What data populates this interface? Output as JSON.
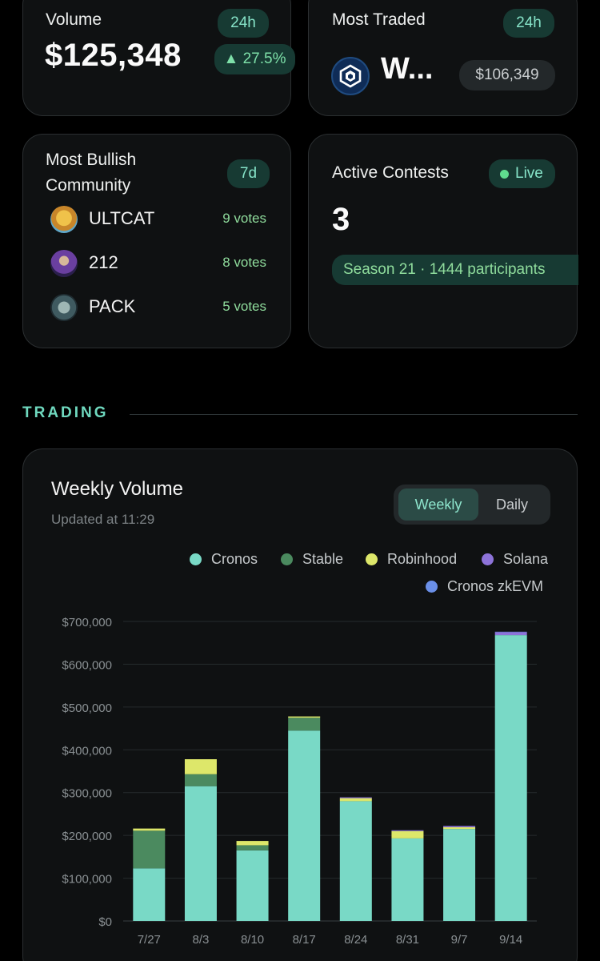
{
  "colors": {
    "accent": "#86e3c8",
    "card_bg": "#0f1112",
    "positive": "#7ee0a9",
    "cronos": "#79d9c6",
    "stable": "#4b8a5f",
    "robinhood": "#dde76a",
    "solana": "#8d73d9",
    "cronos_zkevm": "#6a8fe8"
  },
  "volume_card": {
    "title": "Volume",
    "period": "24h",
    "amount": "$125,348",
    "change": "▲ 27.5%"
  },
  "traded_card": {
    "title": "Most Traded",
    "period": "24h",
    "symbol": "W...",
    "price": "$106,349",
    "logo_icon": "cronos-logo-icon"
  },
  "bullish_card": {
    "title": "Most Bullish Community",
    "period": "7d",
    "communities": [
      {
        "name": "ULTCAT",
        "votes": "9 votes",
        "avatar_icon": "ultcat-avatar"
      },
      {
        "name": "212",
        "votes": "8 votes",
        "avatar_icon": "212-avatar"
      },
      {
        "name": "PACK",
        "votes": "5 votes",
        "avatar_icon": "pack-avatar"
      }
    ]
  },
  "contests_card": {
    "title": "Active Contests",
    "live_label": "Live",
    "count": "3",
    "season_text": "Season 21 · 1444 participants"
  },
  "section": {
    "heading": "TRADING"
  },
  "chart_card": {
    "title": "Weekly Volume",
    "updated": "Updated at 11:29",
    "toggle": {
      "weekly": "Weekly",
      "daily": "Daily",
      "selected": "Weekly"
    }
  },
  "chart_data": {
    "type": "bar",
    "stacked": true,
    "categories": [
      "7/27",
      "8/3",
      "8/10",
      "8/17",
      "8/24",
      "8/31",
      "9/7",
      "9/14"
    ],
    "ylim": [
      0,
      700000
    ],
    "yticks": [
      "$0",
      "$100,000",
      "$200,000",
      "$300,000",
      "$400,000",
      "$500,000",
      "$600,000",
      "$700,000"
    ],
    "ytick_values": [
      0,
      100000,
      200000,
      300000,
      400000,
      500000,
      600000,
      700000
    ],
    "grid": true,
    "legend_position": "top-right",
    "series": [
      {
        "name": "Cronos",
        "color": "#79d9c6",
        "values": [
          123000,
          315000,
          165000,
          445000,
          280000,
          193000,
          215000,
          668000
        ]
      },
      {
        "name": "Stable",
        "color": "#4b8a5f",
        "values": [
          88000,
          28000,
          12000,
          30000,
          0,
          0,
          0,
          0
        ]
      },
      {
        "name": "Robinhood",
        "color": "#dde76a",
        "values": [
          5000,
          35000,
          10000,
          3000,
          7000,
          17000,
          4000,
          0
        ]
      },
      {
        "name": "Solana",
        "color": "#8d73d9",
        "values": [
          0,
          0,
          0,
          0,
          2000,
          2000,
          3000,
          7000
        ]
      },
      {
        "name": "Cronos zkEVM",
        "color": "#6a8fe8",
        "values": [
          0,
          0,
          0,
          0,
          0,
          0,
          0,
          1000
        ]
      }
    ]
  }
}
